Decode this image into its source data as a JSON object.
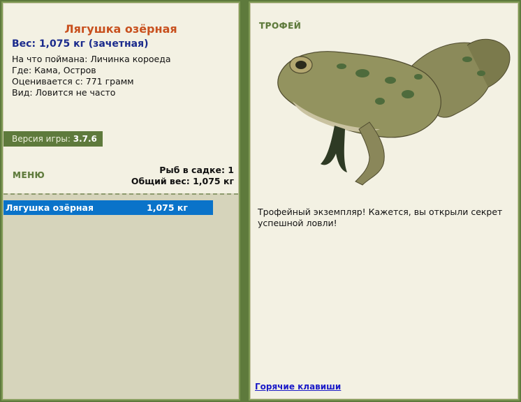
{
  "fish": {
    "name": "Лягушка озёрная",
    "weight_line": "Вес: 1,075 кг (зачетная)",
    "bait_line": "На что поймана: Личинка короеда",
    "place_line": "Где: Кама, Остров",
    "value_line": "Оценивается с: 771 грамм",
    "kind_line": "Вид: Ловится не часто"
  },
  "version": {
    "label": "Версия игры:",
    "value": "3.7.6"
  },
  "menu": {
    "label": "МЕНЮ"
  },
  "stats": {
    "fish_count": "Рыб в садке: 1",
    "total_weight": "Общий вес: 1,075 кг"
  },
  "catch_list": [
    {
      "name": "Лягушка озёрная",
      "weight": "1,075 кг",
      "selected": true
    }
  ],
  "trophy": {
    "label": "ТРОФЕЙ",
    "description": "Трофейный экземпляр! Кажется, вы открыли секрет успешной ловли!"
  },
  "hotkeys": {
    "label": "Горячие клавиши"
  },
  "colors": {
    "accent_green": "#5e7a3c",
    "title_orange": "#c8501e",
    "weight_blue": "#1a2a8c",
    "selection_blue": "#0a73c9"
  }
}
